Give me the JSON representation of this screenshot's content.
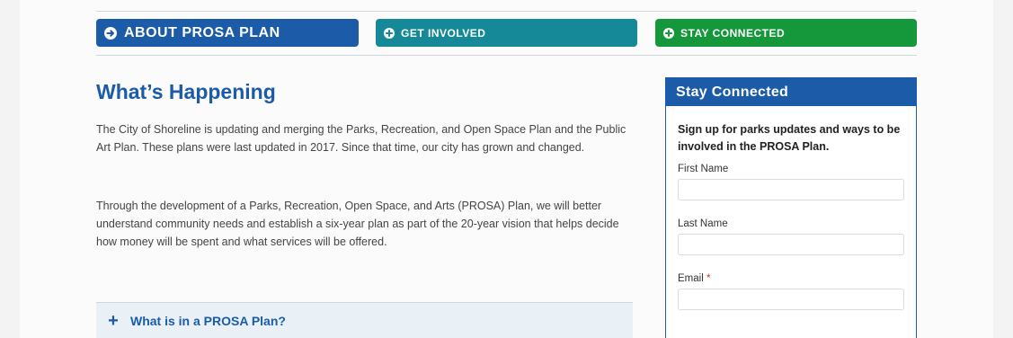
{
  "nav_tabs": [
    {
      "label": "ABOUT PROSA PLAN",
      "color": "#1b5ba8",
      "icon": "arrow-right-circle-icon"
    },
    {
      "label": "GET INVOLVED",
      "color": "#158998",
      "icon": "plus-circle-icon"
    },
    {
      "label": "STAY CONNECTED",
      "color": "#15983b",
      "icon": "plus-circle-icon"
    }
  ],
  "main": {
    "heading": "What’s Happening",
    "paragraphs": [
      "The City of Shoreline is updating and merging the Parks, Recreation, and Open Space Plan and the Public Art Plan. These plans were last updated in 2017. Since that time, our city has grown and changed.",
      "Through the development of a Parks, Recreation, Open Space, and Arts (PROSA) Plan, we will better understand community needs and establish a six-year plan as part of the 20-year vision that helps decide how money will be spent and what services will be offered."
    ],
    "accordion": {
      "icon": "plus-icon",
      "symbol": "+",
      "label": "What is in a PROSA Plan?"
    }
  },
  "sidebar": {
    "title": "Stay Connected",
    "intro": "Sign up for parks updates and ways to be involved in the PROSA Plan.",
    "fields": [
      {
        "label": "First Name",
        "value": ""
      },
      {
        "label": "Last Name",
        "value": ""
      },
      {
        "label": "Email",
        "required_mark": "*",
        "value": ""
      }
    ]
  },
  "colors": {
    "primary_blue": "#1b5ba8",
    "teal": "#158998",
    "green": "#15983b"
  }
}
